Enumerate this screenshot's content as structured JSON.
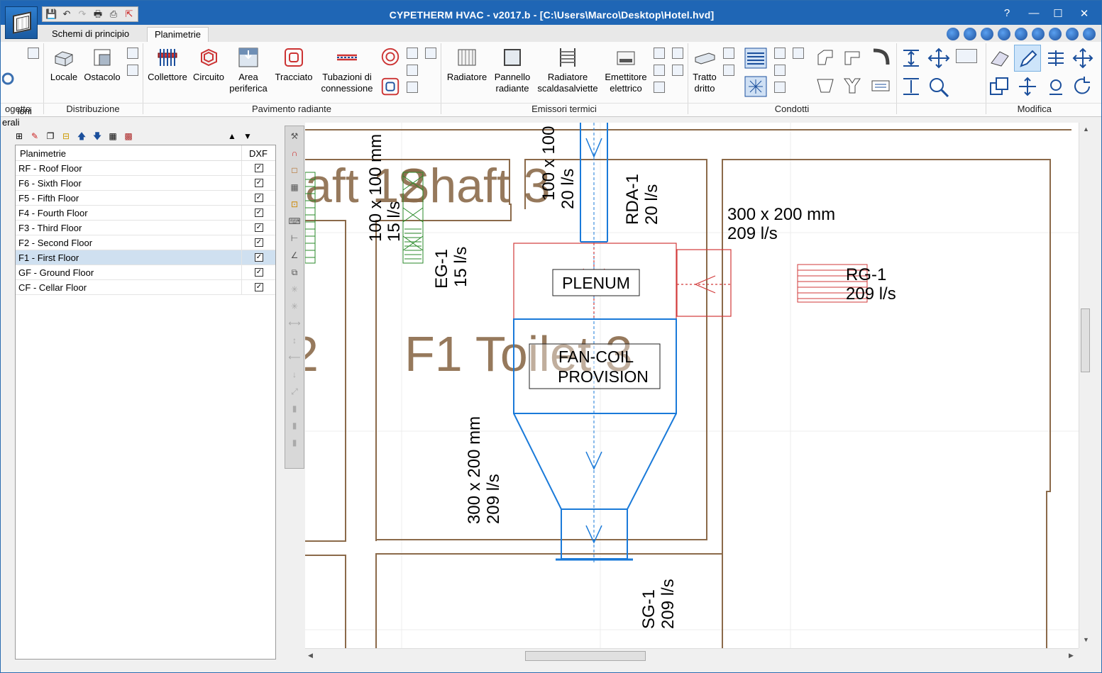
{
  "window": {
    "title": "CYPETHERM HVAC - v2017.b - [C:\\Users\\Marco\\Desktop\\Hotel.hvd]",
    "help": "?",
    "minimize": "—",
    "maximize": "☐",
    "close": "✕"
  },
  "ribbon_tabs": [
    "Schemi di principio",
    "Planimetrie"
  ],
  "ribbon": {
    "progetto_partial_label": "ioni\nerali",
    "buttons": {
      "locale": "Locale",
      "ostacolo": "Ostacolo",
      "collettore": "Collettore",
      "circuito": "Circuito",
      "area_periferica": "Area periferica",
      "tracciato": "Tracciato",
      "tubazioni": "Tubazioni di connessione",
      "radiatore": "Radiatore",
      "pannello": "Pannello radiante",
      "scaldasalviette": "Radiatore scaldasalviette",
      "emettitore": "Emettitore elettrico",
      "tratto": "Tratto dritto"
    },
    "groups": {
      "progetto": "ogetto",
      "distribuzione": "Distribuzione",
      "pavimento": "Pavimento radiante",
      "emissori": "Emissori termici",
      "condotti": "Condotti",
      "modifica": "Modifica"
    }
  },
  "floors_panel": {
    "col_name": "Planimetrie",
    "col_dxf": "DXF",
    "rows": [
      {
        "name": "RF - Roof Floor",
        "dxf": "✓"
      },
      {
        "name": "F6 - Sixth Floor",
        "dxf": "✓"
      },
      {
        "name": "F5 - Fifth Floor",
        "dxf": "✓"
      },
      {
        "name": "F4 - Fourth Floor",
        "dxf": "✓"
      },
      {
        "name": "F3 - Third Floor",
        "dxf": "✓"
      },
      {
        "name": "F2 - Second Floor",
        "dxf": "✓"
      },
      {
        "name": "F1 - First Floor",
        "dxf": "✓"
      },
      {
        "name": "GF - Ground Floor",
        "dxf": "✓"
      },
      {
        "name": "CF - Cellar Floor",
        "dxf": "✓"
      }
    ],
    "selected_row": "F1 - First Floor"
  },
  "drawing": {
    "room_label_1": "aft 12",
    "room_label_2": "Shaft 3",
    "room_label_toilet": "F1 Toilet 3",
    "room_label_partial": "2",
    "duct_top_size": "100 x 100",
    "duct_top_flow": "20 l/s",
    "duct_left_size": "100 x 100 mm",
    "duct_left_flow": "15 l/s",
    "eg_name": "EG-1",
    "eg_flow": "15 l/s",
    "rda_name": "RDA-1",
    "rda_flow": "20 l/s",
    "duct_right_size": "300 x 200 mm",
    "duct_right_flow": "209 l/s",
    "rg_name": "RG-1",
    "rg_flow": "209 l/s",
    "plenum": "PLENUM",
    "fancoil_1": "FAN-COIL",
    "fancoil_2": "PROVISION",
    "duct_vert_size": "300 x 200 mm",
    "duct_vert_flow": "209 l/s",
    "sg_name": "SG-1",
    "sg_flow": "209 l/s"
  },
  "colors": {
    "titlebar": "#1f66b5",
    "wall": "#8b6a4a",
    "duct_blue": "#1a7ad9",
    "plenum_red": "#d23a3a",
    "grille_green": "#2a8a2a"
  }
}
